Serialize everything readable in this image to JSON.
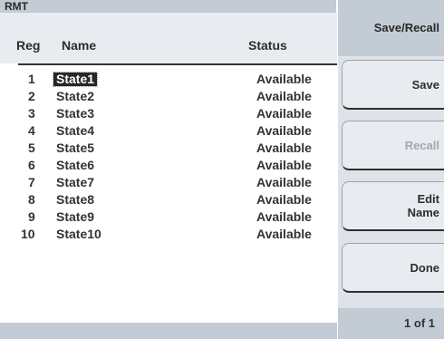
{
  "title_bar": {
    "label": "RMT"
  },
  "table": {
    "headers": {
      "reg": "Reg",
      "name": "Name",
      "status": "Status"
    },
    "rows": [
      {
        "reg": "1",
        "name": "State1",
        "status": "Available",
        "selected": true
      },
      {
        "reg": "2",
        "name": "State2",
        "status": "Available"
      },
      {
        "reg": "3",
        "name": "State3",
        "status": "Available"
      },
      {
        "reg": "4",
        "name": "State4",
        "status": "Available"
      },
      {
        "reg": "5",
        "name": "State5",
        "status": "Available"
      },
      {
        "reg": "6",
        "name": "State6",
        "status": "Available"
      },
      {
        "reg": "7",
        "name": "State7",
        "status": "Available"
      },
      {
        "reg": "8",
        "name": "State8",
        "status": "Available"
      },
      {
        "reg": "9",
        "name": "State9",
        "status": "Available"
      },
      {
        "reg": "10",
        "name": "State10",
        "status": "Available"
      }
    ]
  },
  "softkeys": {
    "menu_title": "Save/Recall",
    "save": "Save",
    "recall": "Recall",
    "edit_line1": "Edit",
    "edit_line2": "Name",
    "done": "Done",
    "page": "1 of 1"
  },
  "colors": {
    "title_bar": "#c3cbd5",
    "softkey_panel": "#dfe3e9",
    "selection": "#262626"
  }
}
